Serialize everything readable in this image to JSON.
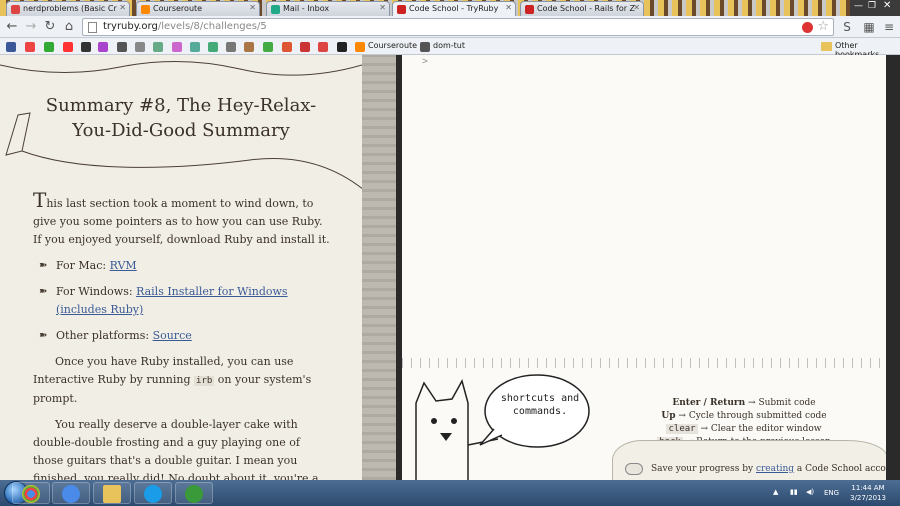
{
  "tabs": [
    {
      "label": "nerdproblems (Basic Cr",
      "fav_color": "#d44",
      "active": false
    },
    {
      "label": "Courseroute",
      "fav_color": "#f80",
      "active": false
    },
    {
      "label": "Mail - Inbox",
      "fav_color": "#2a8",
      "active": false
    },
    {
      "label": "Code School - TryRuby",
      "fav_color": "#c22",
      "active": true
    },
    {
      "label": "Code School - Rails for Z",
      "fav_color": "#c22",
      "active": false
    }
  ],
  "toolbar": {
    "back_icon": "back-arrow-icon",
    "forward_icon": "forward-arrow-icon",
    "reload_icon": "reload-icon",
    "home_icon": "home-icon",
    "url_host": "tryruby.org",
    "url_path": "/levels/8/challenges/5",
    "menu_icon": "menu-icon"
  },
  "bookmarks": {
    "items": [
      {
        "label": "Courseroute",
        "color": "#f80"
      },
      {
        "label": "dom-tut",
        "color": "#555"
      }
    ],
    "other": "Other bookmarks"
  },
  "lesson": {
    "title_line1": "Summary #8, The Hey-Relax-",
    "title_line2": "You-Did-Good Summary",
    "intro_drop": "T",
    "intro": "his last section took a moment to wind down, to give you some pointers as to how you can use Ruby. If you enjoyed yourself, download Ruby and install it.",
    "mac_label": "For Mac: ",
    "mac_link": "RVM",
    "win_label": "For Windows: ",
    "win_link": "Rails Installer for Windows (includes Ruby)",
    "other_label": "Other platforms: ",
    "other_link": "Source",
    "irb_pre": "Once you have Ruby installed, you can use Interactive Ruby by running ",
    "irb_code": "irb",
    "irb_post": " on your system's prompt.",
    "cake": "You really deserve a double-layer cake with double-double frosting and a guy playing one of those guitars that's a double guitar. I mean you finished, you really did! No doubt about it, you're a certified red-blooded smartiac!"
  },
  "editor": {
    "prompt": ">",
    "bubble": "shortcuts and commands.",
    "enter_key": "Enter / Return",
    "enter_desc": " Submit code",
    "up_key": "Up",
    "up_desc": " Cycle through submitted code",
    "clear_key": "clear",
    "clear_desc": " Clear the editor window",
    "back_key": "back",
    "back_desc": " Return to the previous lesson",
    "save_pre": "Save your progress by ",
    "save_link": "creating",
    "save_post": " a Code School account."
  },
  "taskbar": {
    "lang": "ENG",
    "time": "11:44 AM",
    "date": "3/27/2013"
  }
}
